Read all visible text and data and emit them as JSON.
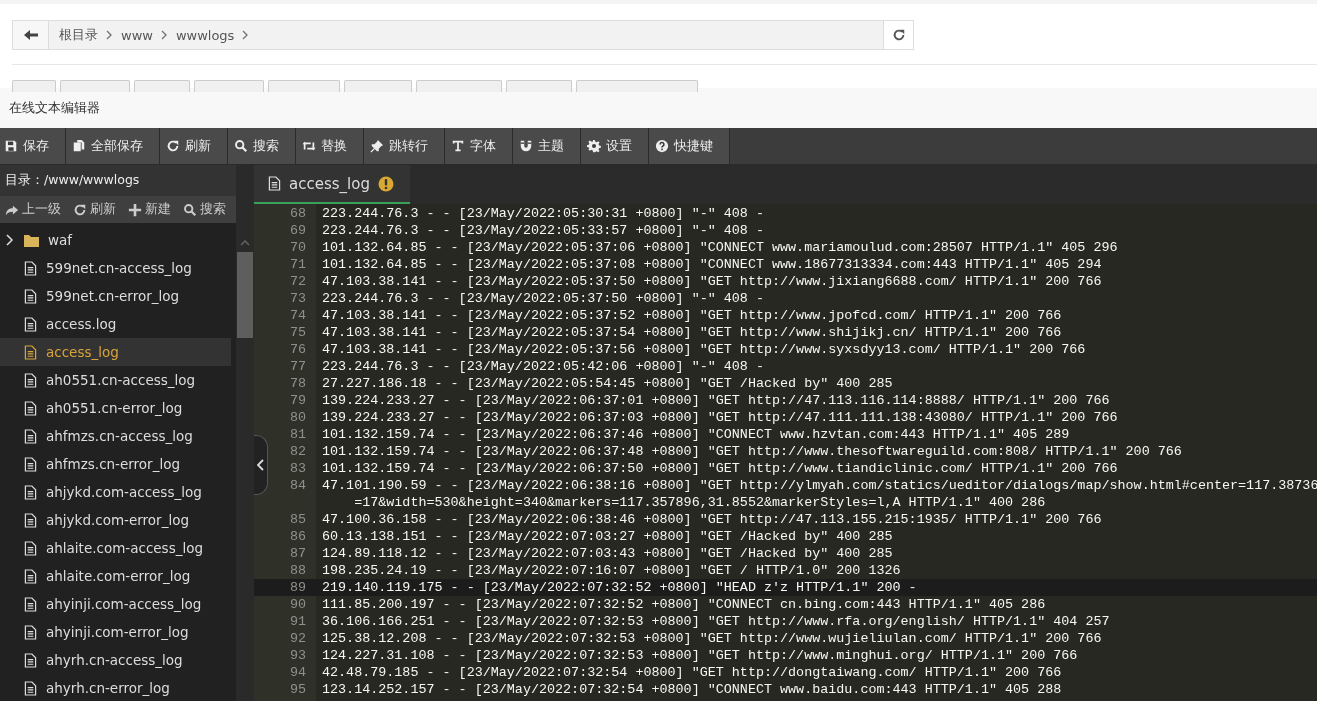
{
  "top_bar": {
    "breadcrumbs": [
      "根目录",
      "www",
      "wwwlogs"
    ]
  },
  "editor": {
    "title": "在线文本编辑器",
    "toolbar": [
      {
        "label": "保存"
      },
      {
        "label": "全部保存"
      },
      {
        "label": "刷新"
      },
      {
        "label": "搜索"
      },
      {
        "label": "替换"
      },
      {
        "label": "跳转行"
      },
      {
        "label": "字体"
      },
      {
        "label": "主题"
      },
      {
        "label": "设置"
      },
      {
        "label": "快捷键"
      }
    ],
    "sidebar": {
      "path": "目录：/www/wwwlogs",
      "actions": [
        {
          "label": "上一级"
        },
        {
          "label": "刷新"
        },
        {
          "label": "新建"
        },
        {
          "label": "搜索"
        }
      ],
      "items": [
        {
          "kind": "folder",
          "name": "waf",
          "selected": false
        },
        {
          "kind": "file",
          "name": "599net.cn-access_log",
          "selected": false
        },
        {
          "kind": "file",
          "name": "599net.cn-error_log",
          "selected": false
        },
        {
          "kind": "file",
          "name": "access.log",
          "selected": false
        },
        {
          "kind": "file",
          "name": "access_log",
          "selected": true
        },
        {
          "kind": "file",
          "name": "ah0551.cn-access_log",
          "selected": false
        },
        {
          "kind": "file",
          "name": "ah0551.cn-error_log",
          "selected": false
        },
        {
          "kind": "file",
          "name": "ahfmzs.cn-access_log",
          "selected": false
        },
        {
          "kind": "file",
          "name": "ahfmzs.cn-error_log",
          "selected": false
        },
        {
          "kind": "file",
          "name": "ahjykd.com-access_log",
          "selected": false
        },
        {
          "kind": "file",
          "name": "ahjykd.com-error_log",
          "selected": false
        },
        {
          "kind": "file",
          "name": "ahlaite.com-access_log",
          "selected": false
        },
        {
          "kind": "file",
          "name": "ahlaite.com-error_log",
          "selected": false
        },
        {
          "kind": "file",
          "name": "ahyinji.com-access_log",
          "selected": false
        },
        {
          "kind": "file",
          "name": "ahyinji.com-error_log",
          "selected": false
        },
        {
          "kind": "file",
          "name": "ahyrh.cn-access_log",
          "selected": false
        },
        {
          "kind": "file",
          "name": "ahyrh.cn-error_log",
          "selected": false
        }
      ]
    },
    "tabs": [
      {
        "label": "access_log",
        "selected": true,
        "unsaved": true
      }
    ],
    "lines": [
      {
        "number": "68",
        "text": "223.244.76.3 - - [23/May/2022:05:30:31 +0800] \"-\" 408 -",
        "current": false
      },
      {
        "number": "69",
        "text": "223.244.76.3 - - [23/May/2022:05:33:57 +0800] \"-\" 408 -",
        "current": false
      },
      {
        "number": "70",
        "text": "101.132.64.85 - - [23/May/2022:05:37:06 +0800] \"CONNECT www.mariamoulud.com:28507 HTTP/1.1\" 405 296",
        "current": false
      },
      {
        "number": "71",
        "text": "101.132.64.85 - - [23/May/2022:05:37:08 +0800] \"CONNECT www.18677313334.com:443 HTTP/1.1\" 405 294",
        "current": false
      },
      {
        "number": "72",
        "text": "47.103.38.141 - - [23/May/2022:05:37:50 +0800] \"GET http://www.jixiang6688.com/ HTTP/1.1\" 200 766",
        "current": false
      },
      {
        "number": "73",
        "text": "223.244.76.3 - - [23/May/2022:05:37:50 +0800] \"-\" 408 -",
        "current": false
      },
      {
        "number": "74",
        "text": "47.103.38.141 - - [23/May/2022:05:37:52 +0800] \"GET http://www.jpofcd.com/ HTTP/1.1\" 200 766",
        "current": false
      },
      {
        "number": "75",
        "text": "47.103.38.141 - - [23/May/2022:05:37:54 +0800] \"GET http://www.shijikj.cn/ HTTP/1.1\" 200 766",
        "current": false
      },
      {
        "number": "76",
        "text": "47.103.38.141 - - [23/May/2022:05:37:56 +0800] \"GET http://www.syxsdyy13.com/ HTTP/1.1\" 200 766",
        "current": false
      },
      {
        "number": "77",
        "text": "223.244.76.3 - - [23/May/2022:05:42:06 +0800] \"-\" 408 -",
        "current": false
      },
      {
        "number": "78",
        "text": "27.227.186.18 - - [23/May/2022:05:54:45 +0800] \"GET /Hacked by\" 400 285",
        "current": false
      },
      {
        "number": "79",
        "text": "139.224.233.27 - - [23/May/2022:06:37:01 +0800] \"GET http://47.113.116.114:8888/ HTTP/1.1\" 200 766",
        "current": false
      },
      {
        "number": "80",
        "text": "139.224.233.27 - - [23/May/2022:06:37:03 +0800] \"GET http://47.111.111.138:43080/ HTTP/1.1\" 200 766",
        "current": false
      },
      {
        "number": "81",
        "text": "101.132.159.74 - - [23/May/2022:06:37:46 +0800] \"CONNECT www.hzvtan.com:443 HTTP/1.1\" 405 289",
        "current": false
      },
      {
        "number": "82",
        "text": "101.132.159.74 - - [23/May/2022:06:37:48 +0800] \"GET http://www.thesoftwareguild.com:808/ HTTP/1.1\" 200 766",
        "current": false
      },
      {
        "number": "83",
        "text": "101.132.159.74 - - [23/May/2022:06:37:50 +0800] \"GET http://www.tiandiclinic.com/ HTTP/1.1\" 200 766",
        "current": false
      },
      {
        "number": "84",
        "text": "47.101.190.59 - - [23/May/2022:06:38:16 +0800] \"GET http://ylmyah.com/statics/ueditor/dialogs/map/show.html#center=117.38736",
        "wrap": "=17&width=530&height=340&markers=117.357896,31.8552&markerStyles=l,A HTTP/1.1\" 400 286",
        "current": false
      },
      {
        "number": "85",
        "text": "47.100.36.158 - - [23/May/2022:06:38:46 +0800] \"GET http://47.113.155.215:1935/ HTTP/1.1\" 200 766",
        "current": false
      },
      {
        "number": "86",
        "text": "60.13.138.151 - - [23/May/2022:07:03:27 +0800] \"GET /Hacked by\" 400 285",
        "current": false
      },
      {
        "number": "87",
        "text": "124.89.118.12 - - [23/May/2022:07:03:43 +0800] \"GET /Hacked by\" 400 285",
        "current": false
      },
      {
        "number": "88",
        "text": "198.235.24.19 - - [23/May/2022:07:16:07 +0800] \"GET / HTTP/1.0\" 200 1326",
        "current": false
      },
      {
        "number": "89",
        "text": "219.140.119.175 - - [23/May/2022:07:32:52 +0800] \"HEAD z'z HTTP/1.1\" 200 -",
        "current": true
      },
      {
        "number": "90",
        "text": "111.85.200.197 - - [23/May/2022:07:32:52 +0800] \"CONNECT cn.bing.com:443 HTTP/1.1\" 405 286",
        "current": false
      },
      {
        "number": "91",
        "text": "36.106.166.251 - - [23/May/2022:07:32:53 +0800] \"GET http://www.rfa.org/english/ HTTP/1.1\" 404 257",
        "current": false
      },
      {
        "number": "92",
        "text": "125.38.12.208 - - [23/May/2022:07:32:53 +0800] \"GET http://www.wujieliulan.com/ HTTP/1.1\" 200 766",
        "current": false
      },
      {
        "number": "93",
        "text": "124.227.31.108 - - [23/May/2022:07:32:53 +0800] \"GET http://www.minghui.org/ HTTP/1.1\" 200 766",
        "current": false
      },
      {
        "number": "94",
        "text": "42.48.79.185 - - [23/May/2022:07:32:54 +0800] \"GET http://dongtaiwang.com/ HTTP/1.1\" 200 766",
        "current": false
      },
      {
        "number": "95",
        "text": "123.14.252.157 - - [23/May/2022:07:32:54 +0800] \"CONNECT www.baidu.com:443 HTTP/1.1\" 405 288",
        "current": false
      }
    ]
  }
}
